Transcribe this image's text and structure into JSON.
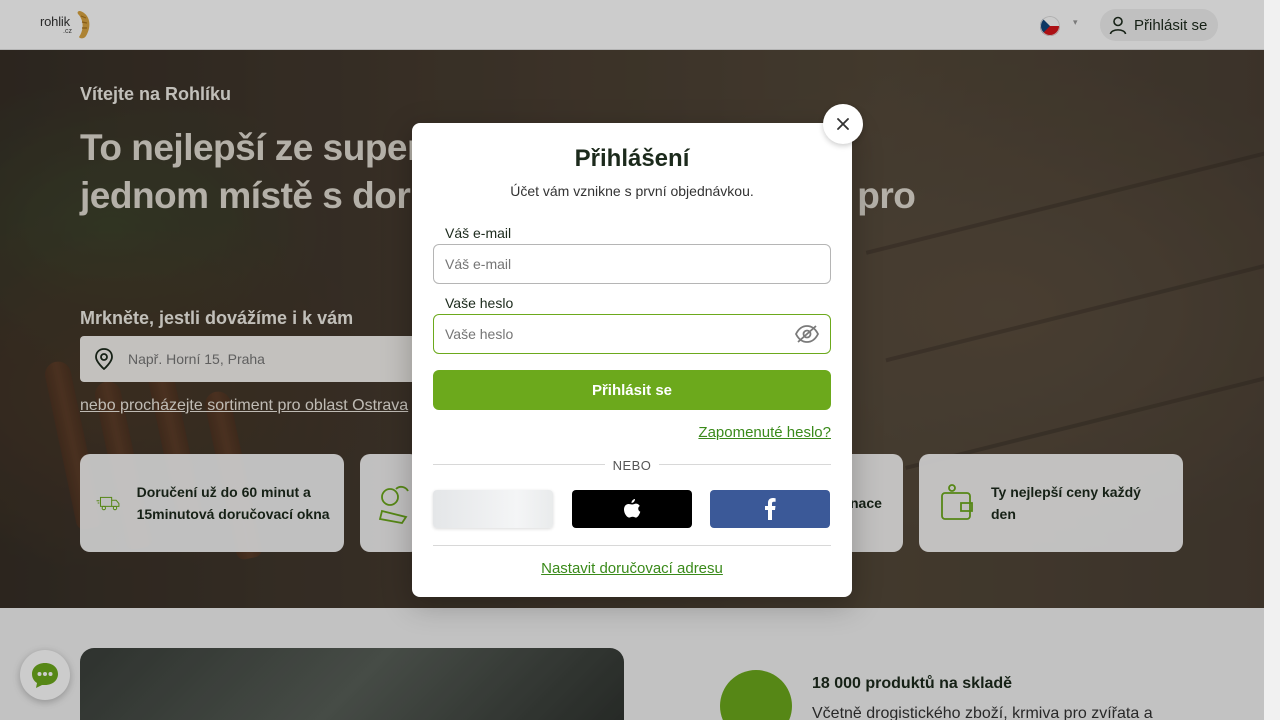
{
  "header": {
    "logo_text": "rohlik",
    "logo_domain": ".cz",
    "language": "cs",
    "login_label": "Přihlásit se"
  },
  "hero": {
    "welcome": "Vítejte na Rohlíku",
    "headline": "To nejlepší ze supermarketů, farem a trhů na jednom místě s doručením dopravou zdarma pro",
    "check_label": "Mrkněte, jestli dovážíme i k vám",
    "address_placeholder": "Např. Horní 15, Praha",
    "browse_link": "nebo procházejte sortiment pro oblast Ostrava"
  },
  "features": [
    {
      "icon": "delivery-truck-icon",
      "text": "Doručení už do 60 minut a 15minutová doručovací okna"
    },
    {
      "icon": "vegetables-icon",
      "text": ""
    },
    {
      "icon": "promo-icon",
      "text": "nace"
    },
    {
      "icon": "wallet-icon",
      "text": "Ty nejlepší ceny každý den"
    }
  ],
  "products": {
    "title": "18 000 produktů na skladě",
    "text": "Včetně drogistického zboží, krmiva pro zvířata a"
  },
  "modal": {
    "title": "Přihlášení",
    "subtitle": "Účet vám vznikne s první objednávkou.",
    "email_label": "Váš e-mail",
    "email_placeholder": "Váš e-mail",
    "password_label": "Vaše heslo",
    "password_placeholder": "Vaše heslo",
    "submit_label": "Přihlásit se",
    "forgot_label": "Zapomenuté heslo?",
    "divider_label": "NEBO",
    "set_address_label": "Nastavit doručovací adresu"
  },
  "colors": {
    "brand_green": "#6ca91c",
    "link_green": "#3a8a1a",
    "facebook_blue": "#3b5998"
  }
}
